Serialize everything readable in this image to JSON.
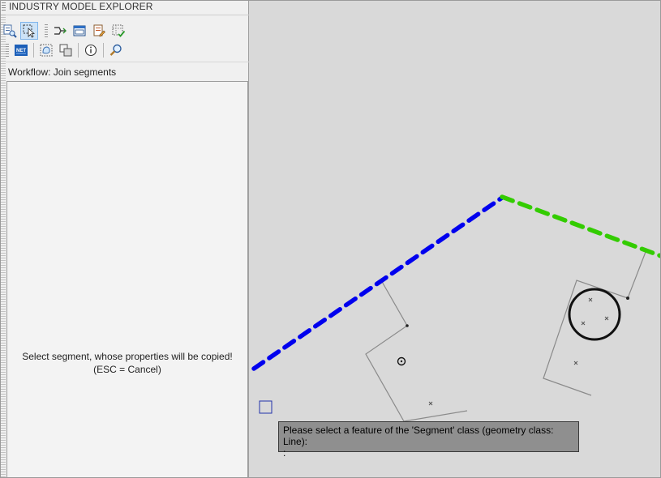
{
  "panel": {
    "title": "INDUSTRY MODEL EXPLORER",
    "workflow_label": "Workflow: Join segments",
    "instructions_line1": "Select segment, whose properties will be copied!",
    "instructions_line2": "(ESC = Cancel)"
  },
  "toolbar1": [
    {
      "icon": "find-feature-icon"
    },
    {
      "icon": "select-feature-icon",
      "active": true
    },
    {
      "icon": "workflow-icon"
    },
    {
      "icon": "form-window-icon"
    },
    {
      "icon": "edit-form-icon"
    },
    {
      "icon": "validate-grid-icon"
    }
  ],
  "toolbar2": [
    {
      "icon": "dotnet-icon"
    },
    {
      "icon": "digitize-area-icon"
    },
    {
      "icon": "overlap-icon"
    },
    {
      "icon": "info-icon"
    },
    {
      "icon": "zoom-icon"
    }
  ],
  "map": {
    "blue_line_color": "#0000ee",
    "green_line_color": "#33cc00",
    "prompt_line1": "Please select a feature of the 'Segment' class (geometry class: Line):",
    "prompt_line2": ":"
  }
}
